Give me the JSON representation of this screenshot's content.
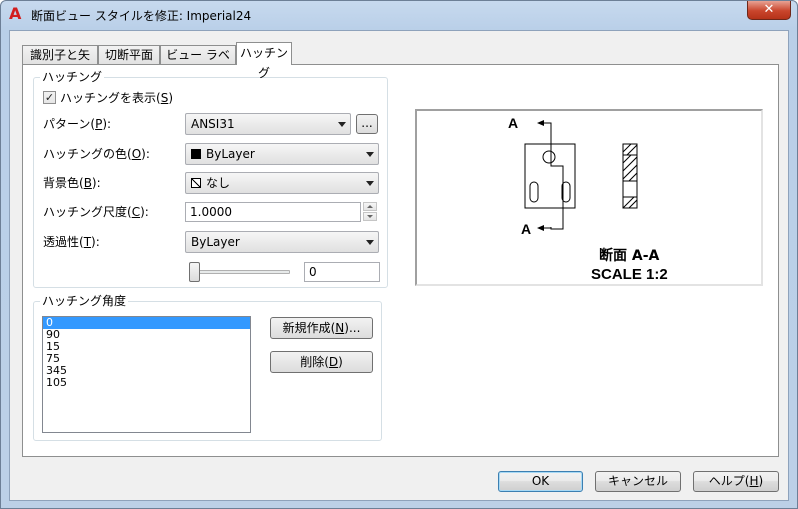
{
  "window": {
    "title": "断面ビュー スタイルを修正: Imperial24",
    "app_icon": "A",
    "close_label": "✕"
  },
  "tabs": [
    {
      "label": "識別子と矢印",
      "active": false
    },
    {
      "label": "切断平面",
      "active": false
    },
    {
      "label": "ビュー ラベル",
      "active": false
    },
    {
      "label": "ハッチング",
      "active": true
    }
  ],
  "hatch": {
    "group_label": "ハッチング",
    "show_hatch": {
      "label": "ハッチングを表示(",
      "hotkey": "S",
      "suffix": ")",
      "checked": true
    },
    "pattern": {
      "label": "パターン(",
      "hotkey": "P",
      "suffix": "):",
      "value": "ANSI31",
      "browse_label": "..."
    },
    "color": {
      "label": "ハッチングの色(",
      "hotkey": "O",
      "suffix": "):",
      "value": "ByLayer"
    },
    "background": {
      "label": "背景色(",
      "hotkey": "B",
      "suffix": "):",
      "value": "なし"
    },
    "scale": {
      "label": "ハッチング尺度(",
      "hotkey": "C",
      "suffix": "):",
      "value": "1.0000"
    },
    "transparency": {
      "label": "透過性(",
      "hotkey": "T",
      "suffix": "):",
      "value": "ByLayer",
      "slider_value": "0"
    }
  },
  "angles": {
    "group_label": "ハッチング角度",
    "items": [
      "0",
      "90",
      "15",
      "75",
      "345",
      "105"
    ],
    "selected_index": 0,
    "new_button": {
      "label": "新規作成(",
      "hotkey": "N",
      "suffix": ")..."
    },
    "delete_button": {
      "label": "削除(",
      "hotkey": "D",
      "suffix": ")"
    }
  },
  "preview": {
    "label_top": "A",
    "label_bottom": "A",
    "caption_line1": "断面 A-A",
    "caption_line2": "SCALE 1:2"
  },
  "footer": {
    "ok": "OK",
    "cancel": "キャンセル",
    "help_label": "ヘルプ(",
    "help_hotkey": "H",
    "help_suffix": ")"
  }
}
